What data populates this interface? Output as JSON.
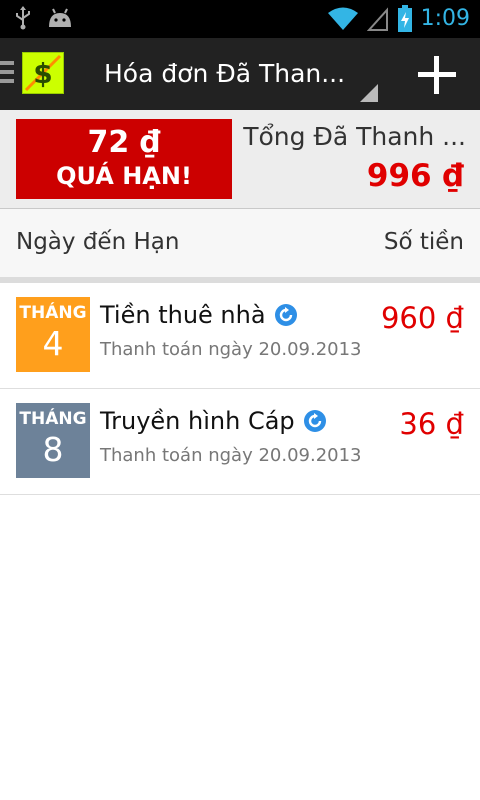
{
  "status_bar": {
    "time": "1:09",
    "left_icons": [
      "usb-icon",
      "android-debug-icon"
    ],
    "right_icons": [
      "wifi-icon",
      "no-signal-icon",
      "battery-charging-icon"
    ]
  },
  "action_bar": {
    "title": "Hóa đơn Đã Than...",
    "icons": [
      "menu-icon",
      "dollar-logo-icon",
      "spinner-icon",
      "add-icon"
    ]
  },
  "summary": {
    "overdue_amount": "72 ₫",
    "overdue_label": "QUÁ HẠN!",
    "total_label": "Tổng Đã Thanh ...",
    "total_amount": "996 ₫"
  },
  "columns": {
    "due_date": "Ngày đến Hạn",
    "amount": "Số tiền"
  },
  "bills": [
    {
      "month_label": "THÁNG",
      "month_number": "4",
      "month_color": "#ff9f1c",
      "name": "Tiền thuê nhà",
      "repeat_icon": "repeat-icon",
      "paid_text": "Thanh toán ngày 20.09.2013",
      "amount": "960 ₫"
    },
    {
      "month_label": "THÁNG",
      "month_number": "8",
      "month_color": "#6d8299",
      "name": "Truyền hình Cáp",
      "repeat_icon": "repeat-icon",
      "paid_text": "Thanh toán ngày 20.09.2013",
      "amount": "36 ₫"
    }
  ],
  "colors": {
    "accent_red": "#e00000",
    "overdue_bg": "#cc0000",
    "clock_blue": "#33b5e5"
  }
}
